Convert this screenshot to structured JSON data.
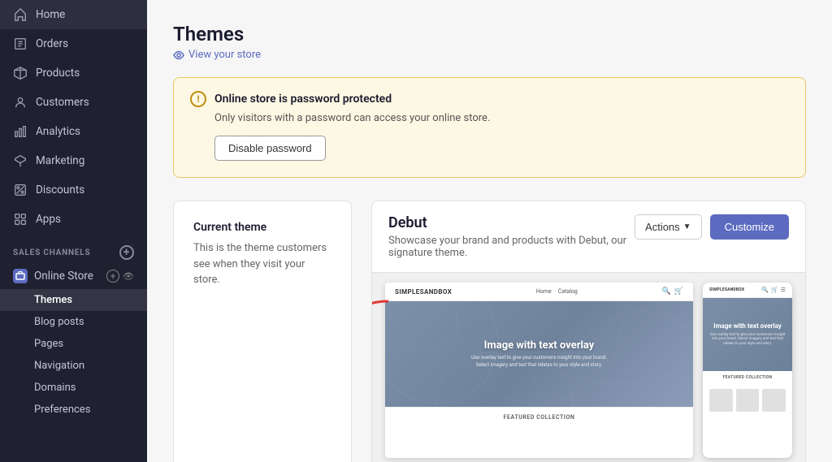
{
  "sidebar": {
    "nav_items": [
      {
        "id": "home",
        "label": "Home",
        "icon": "🏠"
      },
      {
        "id": "orders",
        "label": "Orders",
        "icon": "📋"
      },
      {
        "id": "products",
        "label": "Products",
        "icon": "🏷️"
      },
      {
        "id": "customers",
        "label": "Customers",
        "icon": "👤"
      },
      {
        "id": "analytics",
        "label": "Analytics",
        "icon": "📊"
      },
      {
        "id": "marketing",
        "label": "Marketing",
        "icon": "📣"
      },
      {
        "id": "discounts",
        "label": "Discounts",
        "icon": "🏷"
      },
      {
        "id": "apps",
        "label": "Apps",
        "icon": "🧩"
      }
    ],
    "sales_channels_label": "SALES CHANNELS",
    "online_store_label": "Online Store",
    "sub_items": [
      {
        "id": "themes",
        "label": "Themes",
        "active": true
      },
      {
        "id": "blog-posts",
        "label": "Blog posts",
        "active": false
      },
      {
        "id": "pages",
        "label": "Pages",
        "active": false
      },
      {
        "id": "navigation",
        "label": "Navigation",
        "active": false
      },
      {
        "id": "domains",
        "label": "Domains",
        "active": false
      },
      {
        "id": "preferences",
        "label": "Preferences",
        "active": false
      }
    ]
  },
  "main": {
    "page_title": "Themes",
    "view_store_label": "View your store",
    "warning": {
      "title": "Online store is password protected",
      "description": "Only visitors with a password can access your online store.",
      "button_label": "Disable password"
    },
    "current_theme": {
      "section_title": "Current theme",
      "description": "This is the theme customers see when they visit your store."
    },
    "theme": {
      "name": "Debut",
      "tagline": "Showcase your brand and products with Debut, our signature theme.",
      "actions_label": "Actions",
      "customize_label": "Customize",
      "mockup": {
        "brand": "SIMPLESANDBOX",
        "nav_links": [
          "Home",
          "Catalog"
        ],
        "hero_text": "Image with text overlay",
        "hero_subtext": "Use overlay text to give your customers insight into your brand. Select imagery and text that relates to your style and story.",
        "collection_label": "FEATURED COLLECTION",
        "mobile_hero_text": "Image with text overlay",
        "mobile_hero_subtext": "Use overlay text to give your customers insight into your brand. Select imagery and text that relates to your style and story."
      }
    }
  }
}
